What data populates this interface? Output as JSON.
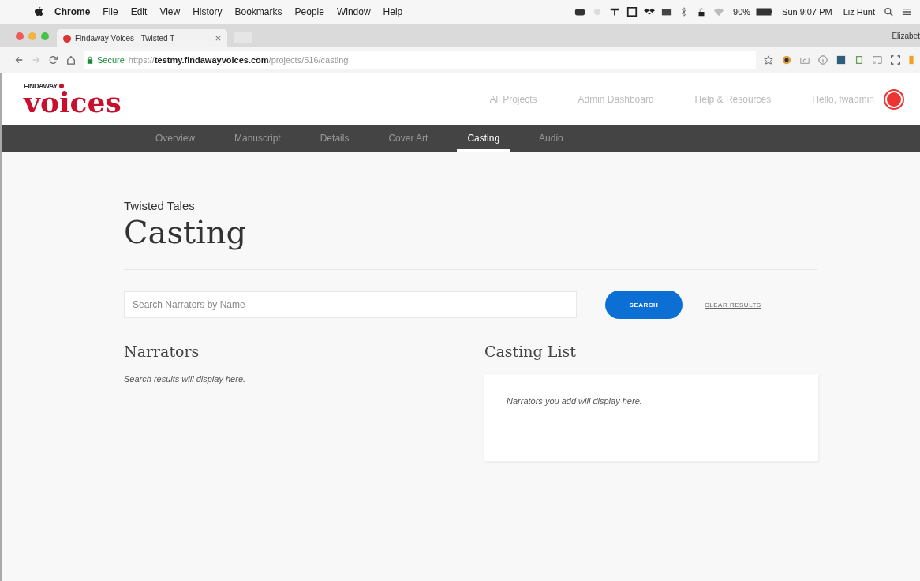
{
  "menu_bar": {
    "app": "Chrome",
    "items": [
      "File",
      "Edit",
      "View",
      "History",
      "Bookmarks",
      "People",
      "Window",
      "Help"
    ],
    "battery": "90%",
    "clock": "Sun 9:07 PM",
    "user": "Liz Hunt"
  },
  "browser": {
    "tab_title": "Findaway Voices - Twisted T",
    "profile": "Elizabet",
    "secure_label": "Secure",
    "url_scheme": "https://",
    "url_host": "testmy.findawayvoices.com",
    "url_path": "/projects/516/casting"
  },
  "site_header": {
    "logo_top": "FINDAWAY",
    "logo_main": "voices",
    "links": [
      "All Projects",
      "Admin Dashboard",
      "Help & Resources"
    ],
    "greeting": "Hello, fwadmin"
  },
  "nav_tabs": [
    {
      "label": "Overview",
      "selected": false
    },
    {
      "label": "Manuscript",
      "selected": false
    },
    {
      "label": "Details",
      "selected": false
    },
    {
      "label": "Cover Art",
      "selected": false
    },
    {
      "label": "Casting",
      "selected": true
    },
    {
      "label": "Audio",
      "selected": false
    }
  ],
  "page": {
    "project": "Twisted Tales",
    "title": "Casting",
    "search": {
      "placeholder": "Search Narrators by Name"
    },
    "search_button": "SEARCH",
    "clear_link": "CLEAR RESULTS",
    "narrators": {
      "heading": "Narrators",
      "empty": "Search results will display here."
    },
    "casting_list": {
      "heading": "Casting List",
      "empty": "Narrators you add will display here."
    }
  }
}
